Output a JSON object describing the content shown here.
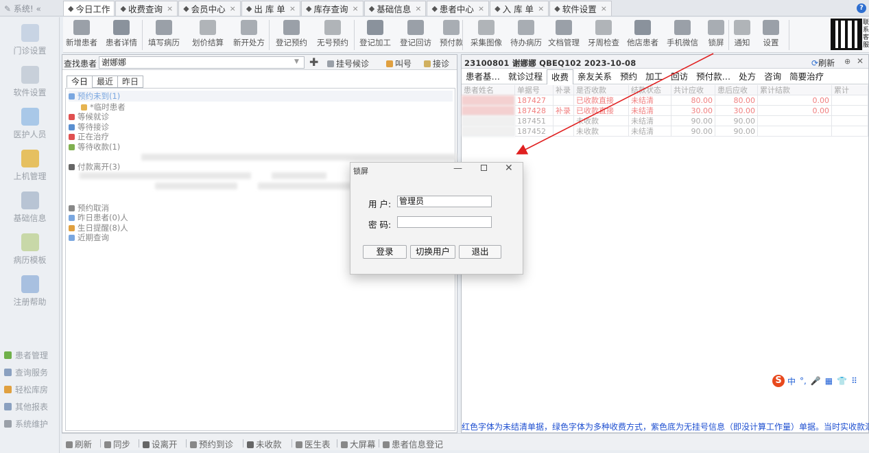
{
  "app": {
    "system_label": "系统!"
  },
  "tabs": [
    {
      "label": "今日工作",
      "icon": "house-icon",
      "closable": false
    },
    {
      "label": "收费查询",
      "icon": "chart-icon",
      "closable": true
    },
    {
      "label": "会员中心",
      "icon": "members-icon",
      "closable": true
    },
    {
      "label": "出 库 单",
      "icon": "outbound-icon",
      "closable": true
    },
    {
      "label": "库存查询",
      "icon": "stock-icon",
      "closable": true
    },
    {
      "label": "基础信息",
      "icon": "info-icon",
      "closable": true
    },
    {
      "label": "患者中心",
      "icon": "patient-icon",
      "closable": true
    },
    {
      "label": "入 库 单",
      "icon": "inbound-icon",
      "closable": true
    },
    {
      "label": "软件设置",
      "icon": "settings-icon",
      "closable": true
    }
  ],
  "sidebar": {
    "items": [
      {
        "label": "门诊设置",
        "icon": "clinic-icon"
      },
      {
        "label": "软件设置",
        "icon": "gear-icon"
      },
      {
        "label": "医护人员",
        "icon": "staff-icon"
      },
      {
        "label": "上机管理",
        "icon": "lock-icon"
      },
      {
        "label": "基础信息",
        "icon": "database-icon"
      },
      {
        "label": "病历模板",
        "icon": "template-icon"
      },
      {
        "label": "注册帮助",
        "icon": "help-book-icon"
      }
    ],
    "bottom": [
      {
        "label": "患者管理",
        "color": "#6fb04a"
      },
      {
        "label": "查询服务",
        "color": "#8aa0c0"
      },
      {
        "label": "轻松库房",
        "color": "#e0a040"
      },
      {
        "label": "其他报表",
        "color": "#8aa0c0"
      },
      {
        "label": "系统维护",
        "color": "#9aa0a8"
      }
    ]
  },
  "toolbar": {
    "buttons": [
      {
        "label": "新增患者",
        "icon": "add-patient-icon"
      },
      {
        "label": "患者详情",
        "icon": "patient-detail-icon"
      },
      {
        "label": "填写病历",
        "icon": "record-icon"
      },
      {
        "label": "划价结算",
        "icon": "yen-icon"
      },
      {
        "label": "新开处方",
        "icon": "pill-icon"
      },
      {
        "label": "登记预约",
        "icon": "calendar-icon"
      },
      {
        "label": "无号预约",
        "icon": "calendar-grid-icon"
      },
      {
        "label": "登记加工",
        "icon": "boxes-icon"
      },
      {
        "label": "登记回访",
        "icon": "refresh-icon"
      },
      {
        "label": "预付款",
        "icon": "prepay-icon"
      },
      {
        "label": "采集图像",
        "icon": "image-icon"
      },
      {
        "label": "待办病历",
        "icon": "todo-icon"
      },
      {
        "label": "文档管理",
        "icon": "doc-icon"
      },
      {
        "label": "牙周检查",
        "icon": "tooth-icon"
      },
      {
        "label": "他店患者",
        "icon": "other-store-icon"
      },
      {
        "label": "手机微信",
        "icon": "phone-icon"
      },
      {
        "label": "锁屏",
        "icon": "padlock-icon"
      },
      {
        "label": "通知",
        "icon": "notice-icon"
      },
      {
        "label": "设置",
        "icon": "cog-icon"
      }
    ],
    "qr_caption": "联系客服"
  },
  "left_panel": {
    "search_label": "查找患者",
    "search_value": "谢娜娜",
    "queue_buttons": [
      {
        "label": "挂号候诊",
        "icon": "queue-icon"
      },
      {
        "label": "叫号",
        "icon": "call-icon"
      },
      {
        "label": "接诊",
        "icon": "receive-icon"
      }
    ],
    "day_tabs": [
      "今日",
      "最近",
      "昨日"
    ],
    "tree": [
      {
        "label": "预约未到(1)",
        "color": "#7aa7e0"
      },
      {
        "label": "*临时患者",
        "color": "#e6b450",
        "indent": true
      },
      {
        "label": "等候就诊",
        "color": "#e05050"
      },
      {
        "label": "等待接诊",
        "color": "#5a8fd0"
      },
      {
        "label": "正在治疗",
        "color": "#e05050"
      },
      {
        "label": "等待收款(1)",
        "color": "#80b050"
      },
      {
        "label": "付款离开(3)",
        "color": "#666666"
      },
      {
        "label": "预约取消",
        "color": "#888888"
      },
      {
        "label": "昨日患者(0)人",
        "color": "#7aa7e0"
      },
      {
        "label": "生日提醒(8)人",
        "color": "#e0a040"
      },
      {
        "label": "近期查询",
        "color": "#7aa7e0"
      }
    ]
  },
  "right_panel": {
    "title": "23100801 谢娜娜 QBEQ102 2023-10-08",
    "refresh_label": "刷新",
    "tabs": [
      "患者基…",
      "就诊过程",
      "收费",
      "亲友关系",
      "预约",
      "加工",
      "回访",
      "预付款…",
      "处方",
      "咨询",
      "简要治疗"
    ],
    "active_tab": "收费",
    "columns": [
      "患者姓名",
      "单据号",
      "补录",
      "是否收款",
      "结款状态",
      "共计应收",
      "患后应收",
      "累计结款",
      "累计"
    ],
    "rows": [
      {
        "bill": "187427",
        "supp": "",
        "paid": "已收款直接",
        "settle": "未结清",
        "total": "80.00",
        "after": "80.00",
        "sum": "0.00",
        "style": "red"
      },
      {
        "bill": "187428",
        "supp": "补录",
        "paid": "已收款直接",
        "settle": "未结清",
        "total": "30.00",
        "after": "30.00",
        "sum": "0.00",
        "style": "red"
      },
      {
        "bill": "187451",
        "supp": "",
        "paid": "未收款",
        "settle": "未结清",
        "total": "90.00",
        "after": "90.00",
        "sum": "",
        "style": "gray"
      },
      {
        "bill": "187452",
        "supp": "",
        "paid": "未收款",
        "settle": "未结清",
        "total": "90.00",
        "after": "90.00",
        "sum": "",
        "style": "gray"
      }
    ],
    "legend": "红色字体为未结清单据，绿色字体为多种收费方式，紫色底为无挂号信息（即没计算工作量）单据。当时实收款汇总"
  },
  "ime": {
    "logo": "S",
    "items": [
      "中",
      "°,",
      "🎤",
      "▦",
      "👕",
      "⠿"
    ]
  },
  "statusbar": [
    {
      "label": "刷新",
      "icon": "refresh-small-icon"
    },
    {
      "label": "同步",
      "icon": "sync-icon"
    },
    {
      "label": "设离开",
      "icon": "leave-icon"
    },
    {
      "label": "预约到诊",
      "icon": "appointment-arrive-icon"
    },
    {
      "label": "未收款",
      "icon": "unpaid-icon"
    },
    {
      "label": "医生表",
      "icon": "doctor-icon"
    },
    {
      "label": "大屏幕",
      "icon": "big-screen-icon"
    },
    {
      "label": "患者信息登记",
      "icon": "register-icon"
    }
  ],
  "dialog": {
    "title": "锁屏",
    "user_label": "用 户:",
    "user_value": "管理员",
    "password_label": "密 码:",
    "password_value": "",
    "buttons": [
      "登录",
      "切换用户",
      "退出"
    ]
  },
  "colors": {
    "accent": "#1e4fd0",
    "unpaid_red": "#f08080",
    "arrow": "#e02020"
  }
}
